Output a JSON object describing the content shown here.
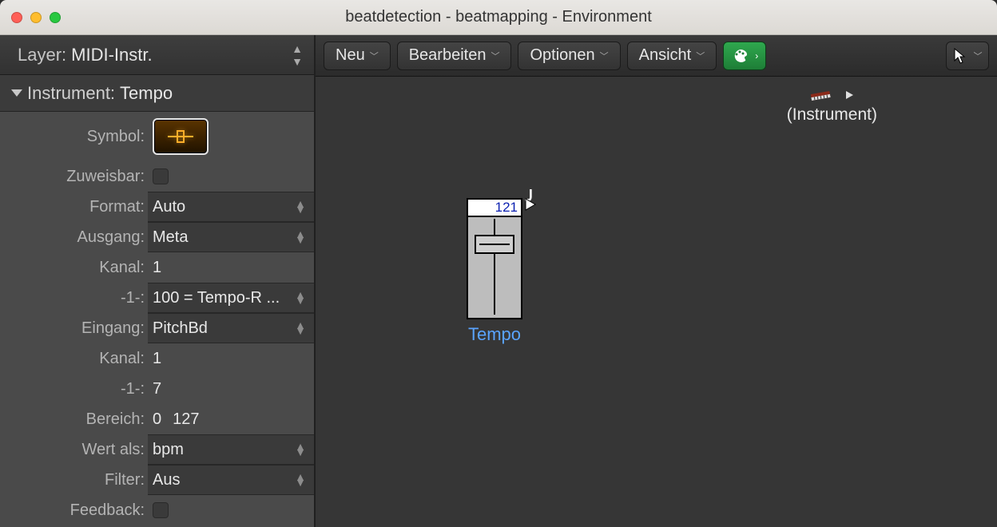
{
  "window": {
    "title": "beatdetection - beatmapping - Environment"
  },
  "inspector": {
    "layer_label": "Layer:",
    "layer_value": "MIDI-Instr.",
    "section_label": "Instrument:",
    "section_value": "Tempo",
    "rows": {
      "symbol_label": "Symbol:",
      "zuweisbar_label": "Zuweisbar:",
      "format_label": "Format:",
      "format_value": "Auto",
      "ausgang_label": "Ausgang:",
      "ausgang_value": "Meta",
      "kanal1_label": "Kanal:",
      "kanal1_value": "1",
      "m1_label": "-1-:",
      "m1_value": "100 = Tempo-R ...",
      "eingang_label": "Eingang:",
      "eingang_value": "PitchBd",
      "kanal2_label": "Kanal:",
      "kanal2_value": "1",
      "m2_label": "-1-:",
      "m2_value": "7",
      "bereich_label": "Bereich:",
      "bereich_v1": "0",
      "bereich_v2": "127",
      "wertals_label": "Wert als:",
      "wertals_value": "bpm",
      "filter_label": "Filter:",
      "filter_value": "Aus",
      "feedback_label": "Feedback:"
    }
  },
  "toolbar": {
    "neu": "Neu",
    "bearbeiten": "Bearbeiten",
    "optionen": "Optionen",
    "ansicht": "Ansicht"
  },
  "canvas": {
    "instrument_label": "(Instrument)",
    "fader_value": "121",
    "fader_label": "Tempo"
  }
}
